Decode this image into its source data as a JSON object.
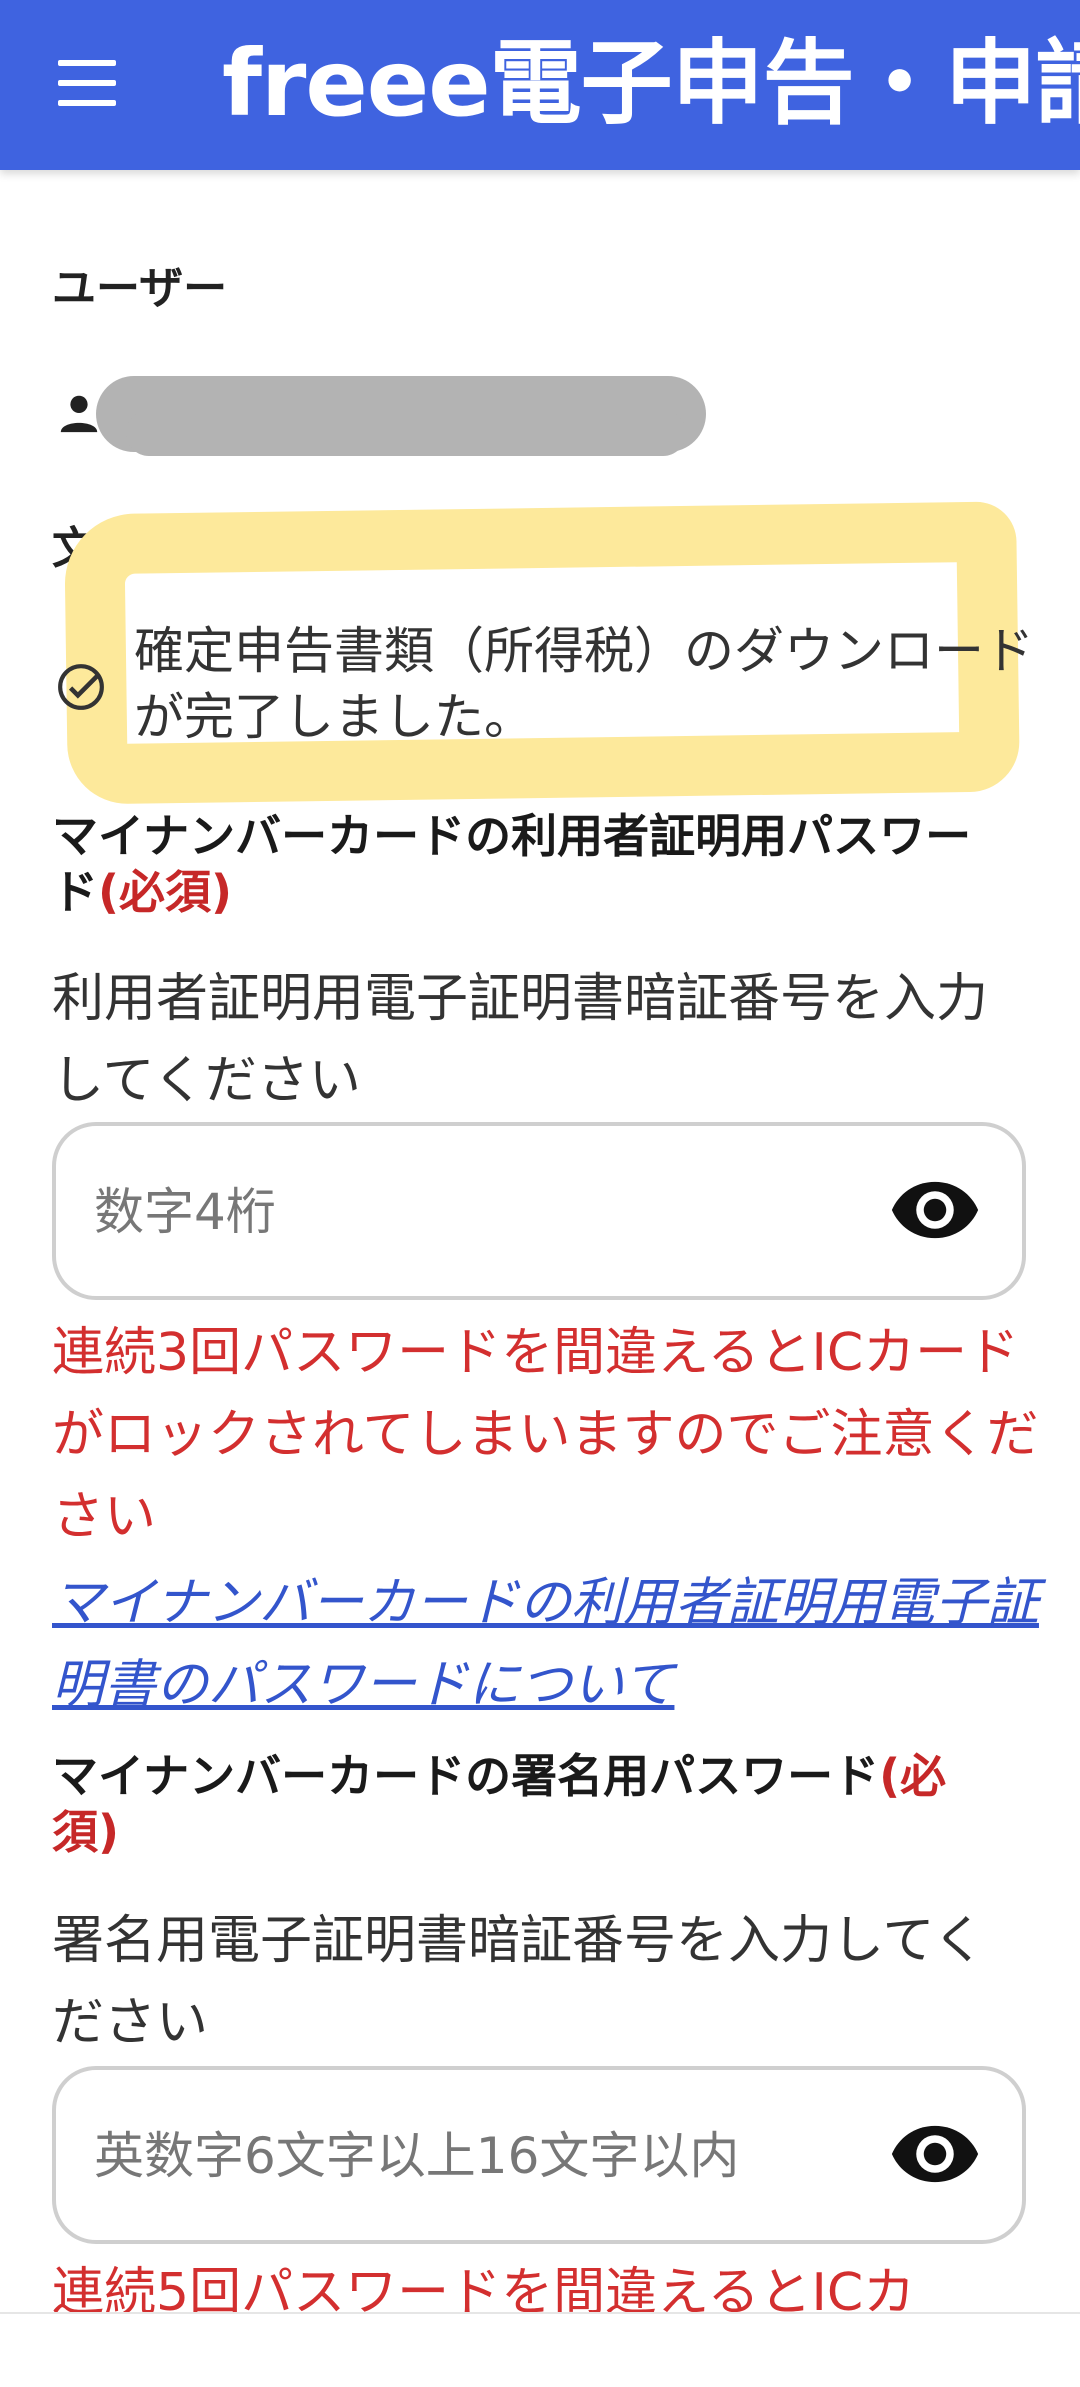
{
  "header": {
    "title": "freee電子申告・申請",
    "menu_icon": "hamburger-menu-icon",
    "background_color": "#3f63e0"
  },
  "user_section": {
    "label": "ユーザー",
    "icon": "person-icon",
    "name": ""
  },
  "document_section": {
    "label": "文書",
    "status_icon": "check-circle-icon",
    "status_text": "確定申告書類（所得税）のダウンロードが完了しました。",
    "highlight_color": "#fde99b"
  },
  "user_cert_password": {
    "label": "マイナンバーカードの利用者証明用パスワード",
    "required": "(必須)",
    "instruction": "利用者証明用電子証明書暗証番号を入力してください",
    "placeholder": "数字4桁",
    "value": "",
    "toggle_icon": "eye-icon",
    "warning": "連続3回パスワードを間違えるとICカードがロックされてしまいますのでご注意ください",
    "help_link": "マイナンバーカードの利用者証明用電子証明書のパスワードについて"
  },
  "signature_password": {
    "label": "マイナンバーカードの署名用パスワード",
    "required": "(必須)",
    "instruction": "署名用電子証明書暗証番号を入力してください",
    "placeholder": "英数字6文字以上16文字以内",
    "value": "",
    "toggle_icon": "eye-icon",
    "warning": "連続5回パスワードを間違えるとICカ"
  },
  "colors": {
    "warning": "#d32f2f",
    "link": "#3355cc",
    "required": "#c62828"
  }
}
